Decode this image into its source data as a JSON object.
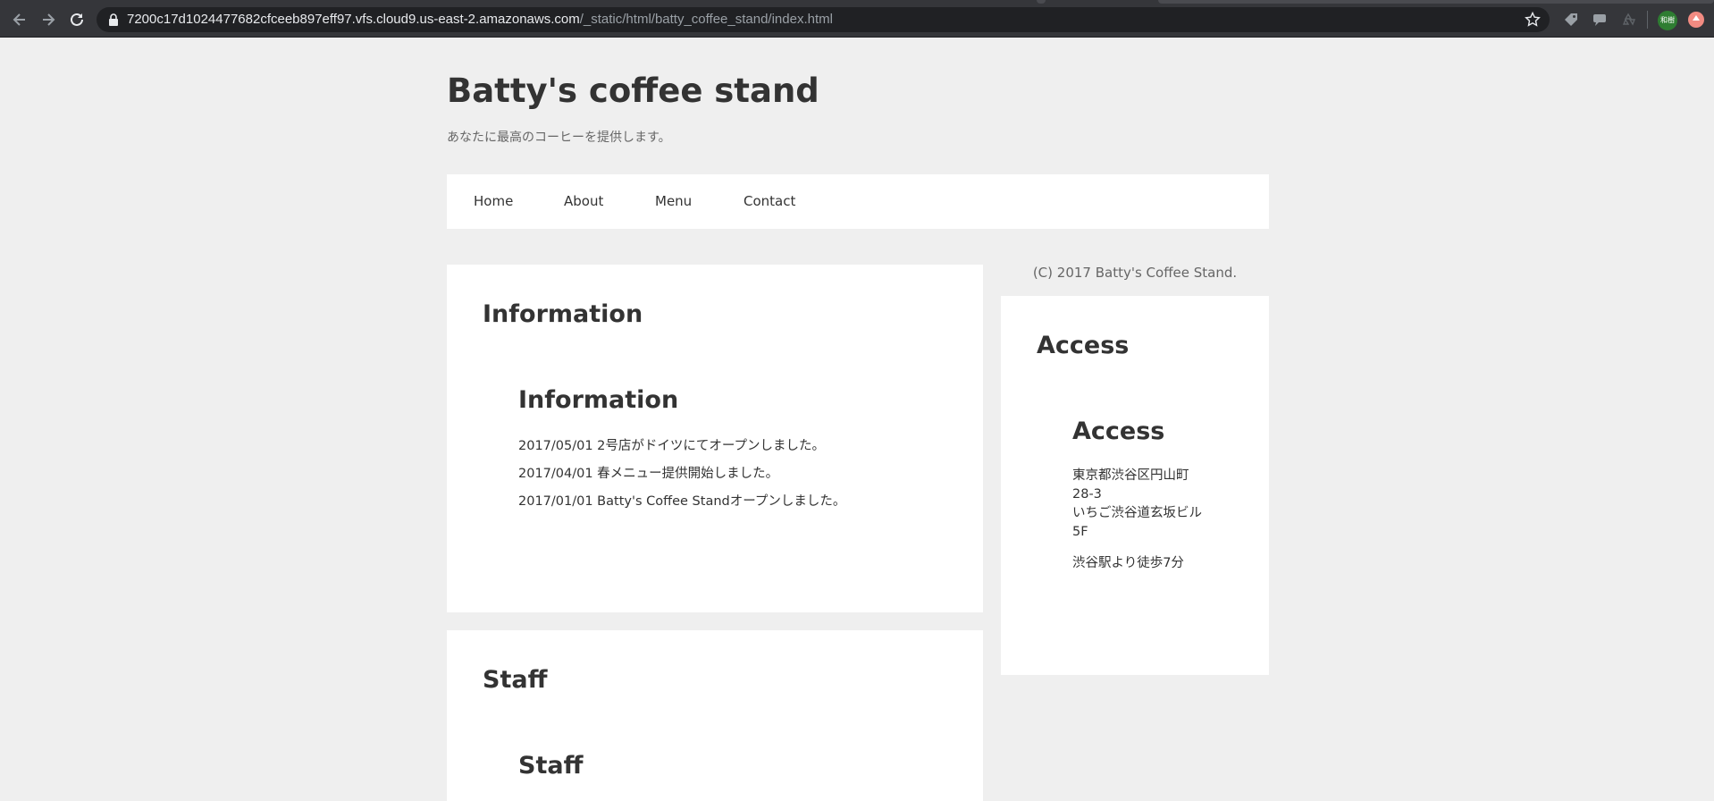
{
  "browser": {
    "url_host": "7200c17d1024477682cfceeb897eff97.vfs.cloud9.us-east-2.amazonaws.com",
    "url_path": "/_static/html/batty_coffee_stand/index.html",
    "profile_initials": "和樹",
    "icons": [
      "back-arrow-icon",
      "forward-arrow-icon",
      "reload-icon",
      "lock-icon",
      "star-icon",
      "extension-tag-icon",
      "extension-chat-icon",
      "extension-recycle-icon",
      "update-icon"
    ]
  },
  "header": {
    "title": "Batty's coffee stand",
    "tagline": "あなたに最高のコーヒーを提供します。"
  },
  "nav": {
    "items": [
      {
        "label": "Home"
      },
      {
        "label": "About"
      },
      {
        "label": "Menu"
      },
      {
        "label": "Contact"
      }
    ]
  },
  "main": {
    "information": {
      "title": "Information",
      "subtitle": "Information",
      "items": [
        "2017/05/01 2号店がドイツにてオープンしました。",
        "2017/04/01 春メニュー提供開始しました。",
        "2017/01/01 Batty's Coffee Standオープンしました。"
      ]
    },
    "staff": {
      "title": "Staff",
      "subtitle": "Staff"
    }
  },
  "sidebar": {
    "copyright": "(C) 2017 Batty's Coffee Stand.",
    "access": {
      "title": "Access",
      "subtitle": "Access",
      "address_lines": [
        "東京都渋谷区円山町",
        "28-3",
        "いちご渋谷道玄坂ビル",
        "5F"
      ],
      "directions": "渋谷駅より徒歩7分"
    }
  }
}
